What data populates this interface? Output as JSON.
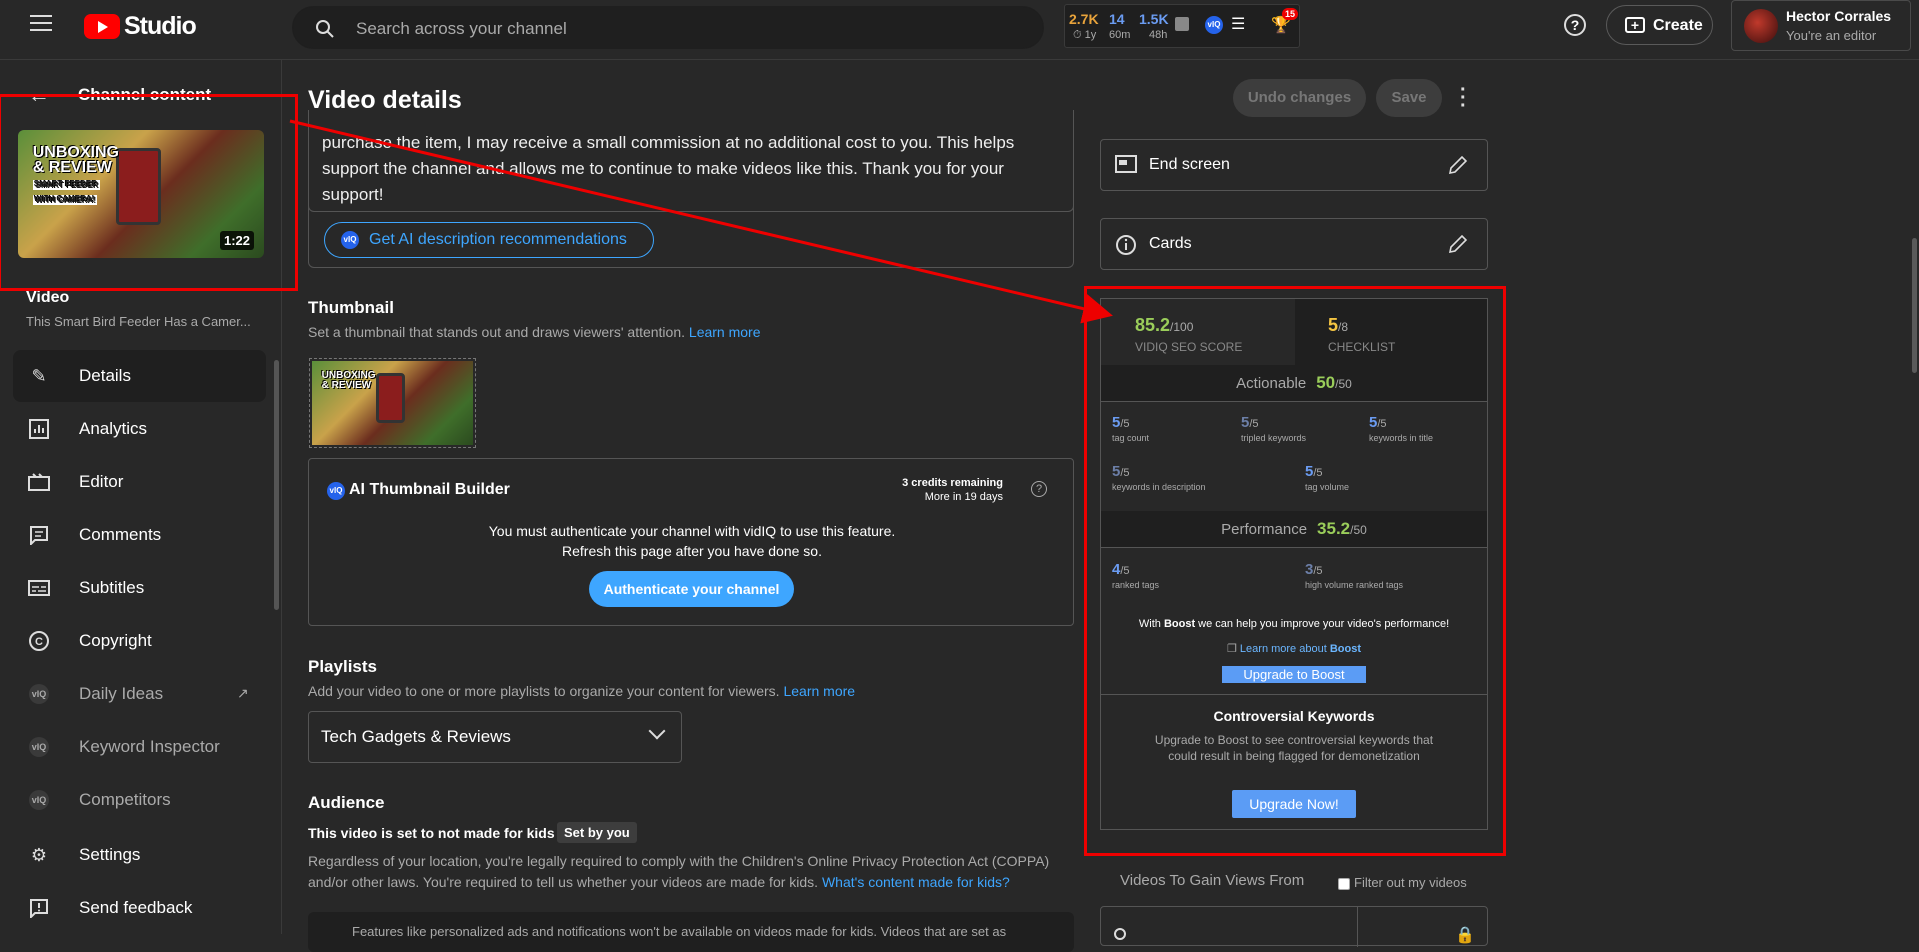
{
  "header": {
    "studio_label": "Studio",
    "search_placeholder": "Search across your channel",
    "vidiq_stats": [
      {
        "value": "2.7K",
        "sub": "1y",
        "color": "#e8a33b"
      },
      {
        "value": "14",
        "sub": "60m",
        "color": "#6b9cf2"
      },
      {
        "value": "1.5K",
        "sub": "48h",
        "color": "#6b9cf2"
      }
    ],
    "trophy_badge": "15",
    "create_label": "Create",
    "user_name": "Hector Corrales",
    "user_role": "You're an editor"
  },
  "sidebar": {
    "channel_content": "Channel content",
    "duration": "1:22",
    "video_label": "Video",
    "video_title": "This Smart Bird Feeder Has a Camer...",
    "thumb_text_line1": "UNBOXING",
    "thumb_text_line2": "& REVIEW",
    "thumb_text_sub": "SMART FEEDER",
    "thumb_text_sub2": "WITH CAMERA!",
    "items": [
      {
        "label": "Details",
        "icon": "pencil-icon"
      },
      {
        "label": "Analytics",
        "icon": "analytics-icon"
      },
      {
        "label": "Editor",
        "icon": "editor-icon"
      },
      {
        "label": "Comments",
        "icon": "comments-icon"
      },
      {
        "label": "Subtitles",
        "icon": "subtitles-icon"
      },
      {
        "label": "Copyright",
        "icon": "copyright-icon"
      },
      {
        "label": "Daily Ideas",
        "icon": "vidiq-icon"
      },
      {
        "label": "Keyword Inspector",
        "icon": "vidiq-icon"
      },
      {
        "label": "Competitors",
        "icon": "vidiq-icon"
      },
      {
        "label": "Settings",
        "icon": "settings-icon"
      },
      {
        "label": "Send feedback",
        "icon": "feedback-icon"
      }
    ]
  },
  "main": {
    "title": "Video details",
    "undo_label": "Undo changes",
    "save_label": "Save",
    "description_text": "purchase the item, I may receive a small commission at no additional cost to you. This helps support the channel and allows me to continue to make videos like this. Thank you for your support!",
    "ai_desc_label": "Get AI description recommendations",
    "thumbnail_heading": "Thumbnail",
    "thumbnail_sub": "Set a thumbnail that stands out and draws viewers' attention.",
    "learn_more": "Learn more",
    "ai_thumb_title": "AI Thumbnail Builder",
    "credits_line1": "3 credits remaining",
    "credits_line2": "More in 19 days",
    "ai_msg_line1": "You must authenticate your channel with vidIQ to use this feature.",
    "ai_msg_line2": "Refresh this page after you have done so.",
    "auth_label": "Authenticate your channel",
    "playlists_heading": "Playlists",
    "playlists_sub": "Add your video to one or more playlists to organize your content for viewers.",
    "playlist_value": "Tech Gadgets & Reviews",
    "audience_heading": "Audience",
    "kids_status": "This video is set to not made for kids",
    "set_by": "Set by you",
    "coppa_text": "Regardless of your location, you're legally required to comply with the Children's Online Privacy Protection Act (COPPA) and/or other laws. You're required to tell us whether your videos are made for kids.",
    "coppa_link": "What's content made for kids?",
    "kids_notice": "Features like personalized ads and notifications won't be available on videos made for kids. Videos that are set as"
  },
  "right": {
    "end_screen": "End screen",
    "cards": "Cards",
    "seo_score": "85.2",
    "seo_max": "/100",
    "seo_label": "VIDIQ SEO SCORE",
    "checklist_score": "5",
    "checklist_max": "/8",
    "checklist_label": "CHECKLIST",
    "actionable_label": "Actionable",
    "actionable_score": "50",
    "actionable_max": "/50",
    "metrics": [
      {
        "value": "5",
        "max": "/5",
        "label": "tag count"
      },
      {
        "value": "5",
        "max": "/5",
        "label": "tripled keywords"
      },
      {
        "value": "5",
        "max": "/5",
        "label": "keywords in title"
      },
      {
        "value": "5",
        "max": "/5",
        "label": "keywords in description"
      },
      {
        "value": "5",
        "max": "/5",
        "label": "tag volume"
      }
    ],
    "performance_label": "Performance",
    "performance_score": "35.2",
    "performance_max": "/50",
    "perf_metrics": [
      {
        "value": "4",
        "max": "/5",
        "label": "ranked tags"
      },
      {
        "value": "3",
        "max": "/5",
        "label": "high volume ranked tags"
      }
    ],
    "boost_pre": "With",
    "boost_word": "Boost",
    "boost_post": "we can help you improve your video's performance!",
    "boost_link_pre": "Learn more about",
    "boost_link_word": "Boost",
    "upgrade_boost": "Upgrade to Boost",
    "controversial_title": "Controversial Keywords",
    "controversial_body": "Upgrade to Boost to see controversial keywords that could result in being flagged for demonetization",
    "upgrade_now": "Upgrade Now!",
    "gain_title": "Videos To Gain Views From",
    "filter_label": "Filter out my videos"
  },
  "colors": {
    "accent": "#3ea6ff",
    "annotation": "#ee0000",
    "seo_green": "#9acd5a",
    "checklist_yellow": "#f5c542"
  }
}
